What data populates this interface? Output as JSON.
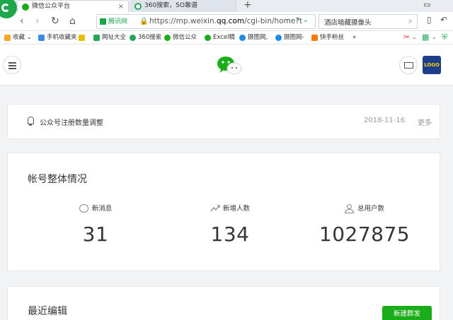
{
  "browser": {
    "tabs": [
      {
        "title": "微信公众平台",
        "active": true
      },
      {
        "title": "360搜索，SO靠谱",
        "active": false
      }
    ],
    "new_tab": "+",
    "nav": {
      "back": "‹",
      "forward": "›",
      "reload": "↻",
      "home": "⌂"
    },
    "address": {
      "site_badge": "腾讯网",
      "url_prefix": "https://mp.weixin.",
      "url_domain": "qq.com",
      "url_suffix": "/cgi-bin/home?t"
    },
    "search": {
      "query": "酒店暗藏摄像头"
    },
    "bookmarks": [
      {
        "label": "收藏",
        "color": "#f5a623"
      },
      {
        "label": "手机收藏夹",
        "color": "#3b8be0"
      },
      {
        "label": "",
        "color": "#e8c000"
      },
      {
        "label": "网址大全",
        "color": "#26a65b"
      },
      {
        "label": "360搜索",
        "color": "#26a65b"
      },
      {
        "label": "微信公众",
        "color": "#1aad19"
      },
      {
        "label": "Excel精",
        "color": "#1aad19"
      },
      {
        "label": "摄图网,",
        "color": "#1e88e5"
      },
      {
        "label": "摄图网-",
        "color": "#1e88e5"
      },
      {
        "label": "快手粉丝",
        "color": "#f57c00"
      },
      {
        "label": "»",
        "color": ""
      }
    ],
    "accent": "#1ea84b"
  },
  "wx_header": {
    "brand_color": "#1aad19",
    "avatar_text": "LOGO"
  },
  "notice": {
    "text": "公众号注册数量调整",
    "date": "2018-11-16",
    "more": "更多"
  },
  "stats": {
    "title": "帐号整体情况",
    "items": [
      {
        "label": "新消息",
        "value": "31",
        "icon": "message-bubble-icon"
      },
      {
        "label": "新增人数",
        "value": "134",
        "icon": "trend-up-icon"
      },
      {
        "label": "总用户数",
        "value": "1027875",
        "icon": "user-icon"
      }
    ]
  },
  "recent": {
    "title": "最近编辑",
    "new_button": "新建群发"
  }
}
